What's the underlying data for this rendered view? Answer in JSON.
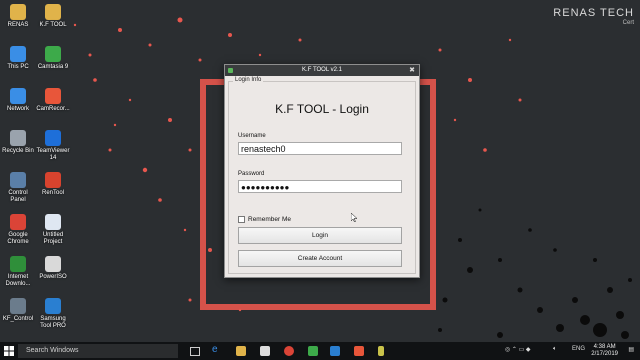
{
  "watermark": {
    "title": "RENAS TECH",
    "subtitle": "Cert"
  },
  "desktop_icons": [
    {
      "label": "RENAS",
      "icon": "folder-icon",
      "color": "#e0b34a"
    },
    {
      "label": "K.F TOOL",
      "icon": "folder-icon",
      "color": "#e0b34a"
    },
    {
      "label": "This PC",
      "icon": "computer-icon",
      "color": "#3a8ee6"
    },
    {
      "label": "Camtasia 9",
      "icon": "camtasia-icon",
      "color": "#3daa4a"
    },
    {
      "label": "Network",
      "icon": "network-icon",
      "color": "#3a8ee6"
    },
    {
      "label": "CamRecor...",
      "icon": "camrec-icon",
      "color": "#e8563a"
    },
    {
      "label": "Recycle Bin",
      "icon": "recycle-bin-icon",
      "color": "#9aa3ad"
    },
    {
      "label": "TeamViewer 14",
      "icon": "teamviewer-icon",
      "color": "#1e6fd9"
    },
    {
      "label": "Control Panel",
      "icon": "control-panel-icon",
      "color": "#5a7fa8"
    },
    {
      "label": "RenTool",
      "icon": "rentool-icon",
      "color": "#d8432e"
    },
    {
      "label": "Google Chrome",
      "icon": "chrome-icon",
      "color": "#db4437"
    },
    {
      "label": "Untitled Project",
      "icon": "document-icon",
      "color": "#dfe7f2"
    },
    {
      "label": "Internet Downlo...",
      "icon": "idm-icon",
      "color": "#2f8f3a"
    },
    {
      "label": "PowerISO",
      "icon": "poweriso-icon",
      "color": "#d9d9d9"
    },
    {
      "label": "KF_Control",
      "icon": "kf-control-icon",
      "color": "#6b7c8c"
    },
    {
      "label": "Samsung Tool PRO",
      "icon": "samsung-tool-icon",
      "color": "#2a7fd1"
    }
  ],
  "dialog": {
    "title": "K.F TOOL v2.1",
    "close_glyph": "✖",
    "group_title": "Login Info",
    "heading": "K.F TOOL - Login",
    "username_label": "Username",
    "username_value": "renastech0",
    "password_label": "Password",
    "password_value": "●●●●●●●●●●",
    "remember_label": "Remember Me",
    "login_label": "Login",
    "create_label": "Create Account"
  },
  "taskbar": {
    "search_placeholder": "Search Windows",
    "tray_lang": "ENG",
    "time": "4:38 AM",
    "date": "2/17/2019"
  }
}
